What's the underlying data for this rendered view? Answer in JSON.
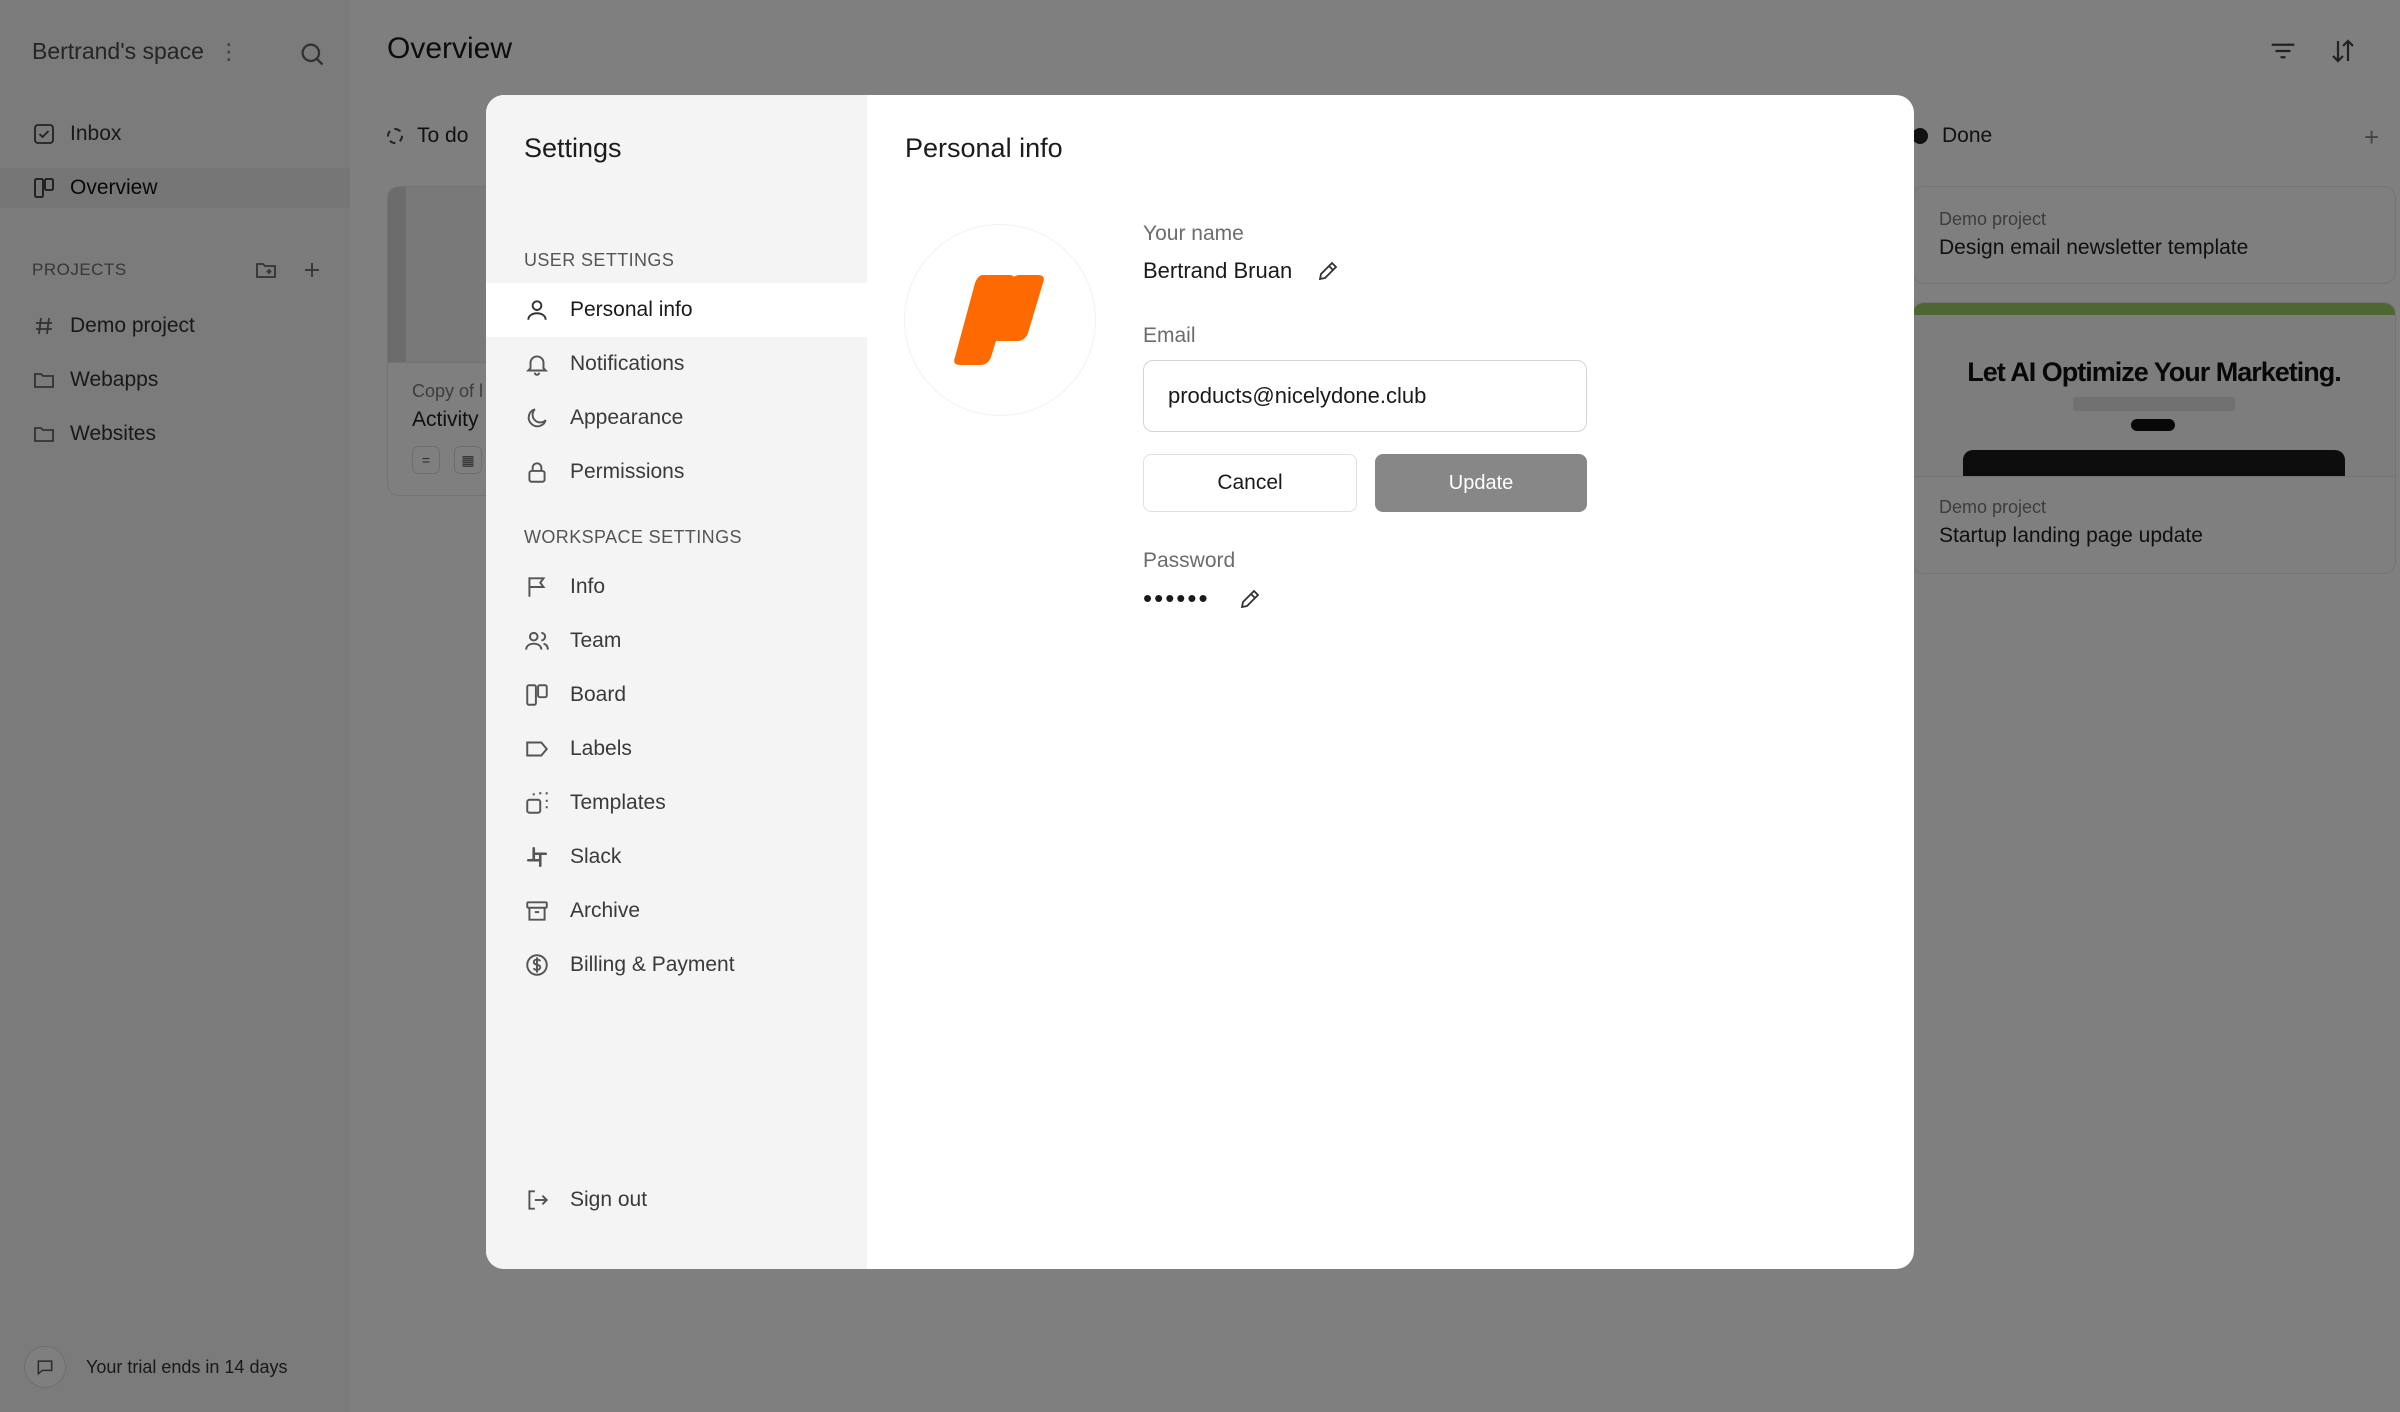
{
  "sidebar": {
    "workspace_name": "Bertrand's space",
    "nav": [
      {
        "label": "Inbox",
        "icon": "inbox-check-icon"
      },
      {
        "label": "Overview",
        "icon": "board-icon"
      }
    ],
    "projects_label": "PROJECTS",
    "projects": [
      {
        "label": "Demo project",
        "icon": "hash-icon"
      },
      {
        "label": "Webapps",
        "icon": "folder-icon"
      },
      {
        "label": "Websites",
        "icon": "folder-icon"
      }
    ],
    "trial_text": "Your trial ends in 14 days"
  },
  "main": {
    "title": "Overview",
    "columns": [
      {
        "label": "To do"
      },
      {
        "label": "Done"
      }
    ],
    "todo_card": {
      "project": "Copy of l",
      "title": "Activity"
    },
    "done_cards": [
      {
        "project": "Demo project",
        "title": "Design email newsletter template"
      },
      {
        "project": "Demo project",
        "title": "Startup landing page update",
        "preview_headline": "Let AI Optimize Your Marketing."
      }
    ]
  },
  "settings": {
    "title": "Settings",
    "user_section_label": "USER SETTINGS",
    "user_items": [
      {
        "label": "Personal info",
        "icon": "user-icon"
      },
      {
        "label": "Notifications",
        "icon": "bell-icon"
      },
      {
        "label": "Appearance",
        "icon": "moon-icon"
      },
      {
        "label": "Permissions",
        "icon": "lock-icon"
      }
    ],
    "workspace_section_label": "WORKSPACE SETTINGS",
    "workspace_items": [
      {
        "label": "Info",
        "icon": "flag-icon"
      },
      {
        "label": "Team",
        "icon": "users-icon"
      },
      {
        "label": "Board",
        "icon": "board-icon"
      },
      {
        "label": "Labels",
        "icon": "tag-icon"
      },
      {
        "label": "Templates",
        "icon": "templates-icon"
      },
      {
        "label": "Slack",
        "icon": "slack-icon"
      },
      {
        "label": "Archive",
        "icon": "archive-icon"
      },
      {
        "label": "Billing & Payment",
        "icon": "dollar-circle-icon"
      }
    ],
    "sign_out_label": "Sign out"
  },
  "personal_info": {
    "heading": "Personal info",
    "name_label": "Your name",
    "name_value": "Bertrand Bruan",
    "email_label": "Email",
    "email_value": "products@nicelydone.club",
    "cancel_label": "Cancel",
    "update_label": "Update",
    "password_label": "Password",
    "password_mask": "••••••"
  },
  "colors": {
    "brand_orange": "#ff6a00",
    "update_button": "#878787",
    "overlay": "rgba(0,0,0,0.5)"
  }
}
